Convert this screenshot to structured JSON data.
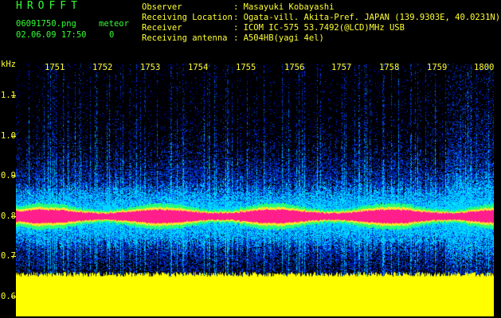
{
  "header": {
    "brand": "HROFFT",
    "file_name": "06091750.png",
    "meteor_label": "meteor",
    "datetime": "02.06.09 17:50",
    "meteor_count": "0"
  },
  "info": [
    {
      "label": "Observer",
      "value": ": Masayuki Kobayashi"
    },
    {
      "label": "Receiving Location",
      "value": ": Ogata-vill. Akita-Pref. JAPAN (139.9303E, 40.0231N)"
    },
    {
      "label": "Receiver",
      "value": ": ICOM IC-575 53.7492(@LCD)MHz USB"
    },
    {
      "label": "Receiving antenna",
      "value": ": A504HB(yagi 4el)"
    }
  ],
  "chart_data": {
    "type": "heatmap",
    "ylabel": "kHz",
    "x_ticks": [
      "1751",
      "1752",
      "1753",
      "1754",
      "1755",
      "1756",
      "1757",
      "1758",
      "1759",
      "1800"
    ],
    "y_ticks": [
      "1.1",
      "1.0",
      "0.9",
      "0.8",
      "0.7",
      "0.6"
    ],
    "ylim": [
      0.55,
      1.18
    ],
    "carrier_khz": 0.8,
    "colors": {
      "background": "#000000",
      "noise": "#0033ff",
      "signal": "#ff3399",
      "mid": "#00ff66",
      "floor": "#ffff00"
    }
  }
}
